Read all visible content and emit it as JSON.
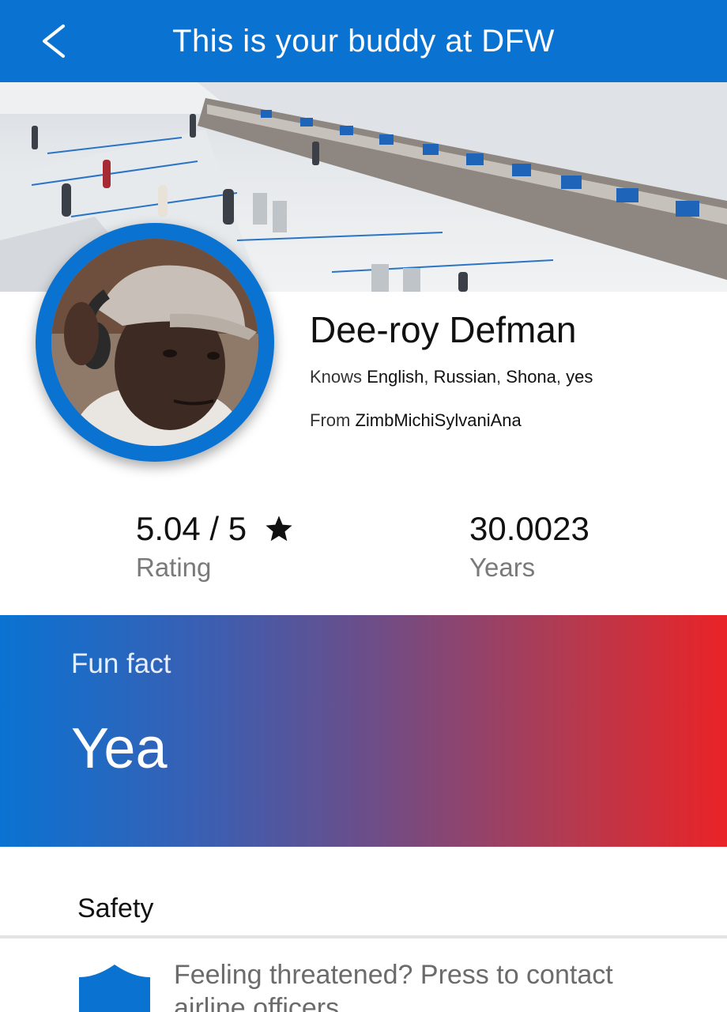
{
  "header": {
    "title": "This is your buddy at DFW",
    "back_icon": "chevron-left-icon"
  },
  "hero": {
    "image": "airport-terminal-photo"
  },
  "profile": {
    "avatar": "buddy-avatar-photo",
    "name": "Dee-roy Defman",
    "knows_label": "Knows",
    "languages": [
      "English",
      "Russian",
      "Shona",
      "yes"
    ],
    "from_label": "From",
    "from_value": "ZimbMichiSylvaniAna"
  },
  "stats": {
    "rating_value": "5.04 / 5",
    "rating_label": "Rating",
    "rating_icon": "star-icon",
    "years_value": "30.0023",
    "years_label": "Years"
  },
  "funfact": {
    "label": "Fun fact",
    "value": "Yea"
  },
  "safety": {
    "title": "Safety",
    "icon": "shield-icon",
    "text": "Feeling threatened? Press to contact airline officers"
  },
  "colors": {
    "brand_blue": "#0a73d2",
    "gradient_end_red": "#ea2327"
  }
}
